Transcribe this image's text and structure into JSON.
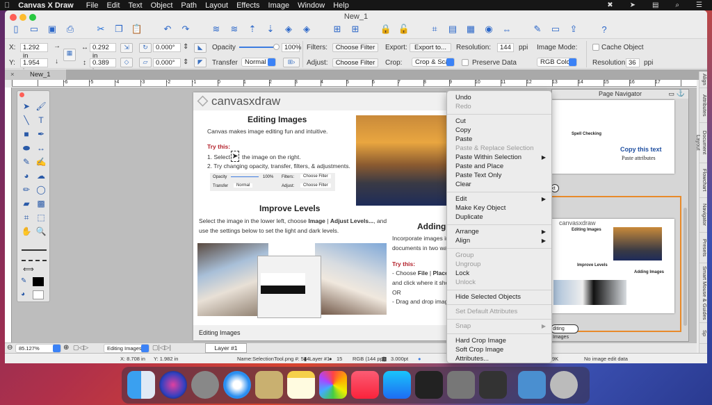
{
  "menubar": {
    "apple": "",
    "app": "Canvas X Draw",
    "items": [
      "File",
      "Edit",
      "Text",
      "Object",
      "Path",
      "Layout",
      "Effects",
      "Image",
      "Window",
      "Help"
    ],
    "status_icons": [
      "toolbox-icon",
      "cursor-icon",
      "flag-us-icon",
      "search-icon",
      "list-icon"
    ]
  },
  "window": {
    "title": "New_1",
    "tab": "New_1"
  },
  "toolbar": {
    "icons": [
      "new-document-icon",
      "open-icon",
      "save-icon",
      "print-icon",
      "cut-icon",
      "copy-icon",
      "paste-icon",
      "undo-icon",
      "redo-icon",
      "layer-back-icon",
      "layer-forward-icon",
      "move-up-icon",
      "move-down-icon",
      "bring-front-icon",
      "send-back-icon",
      "grid-icon",
      "grid-alt-icon",
      "lock-icon",
      "unlock-icon",
      "crop-icon",
      "frame-icon",
      "image-icon",
      "record-icon",
      "flip-icon",
      "edit-icon",
      "present-icon",
      "export-icon",
      "help-icon"
    ]
  },
  "props": {
    "x_label": "X:",
    "x_value": "1.292 in",
    "y_label": "Y:",
    "y_value": "1.954 in",
    "width_value": "0.292 in",
    "height_value": "0.389 in",
    "rotation_value": "0.000°",
    "skew_value": "0.000°",
    "opacity_label": "Opacity",
    "opacity_value": "100%",
    "opacity_percent": 100,
    "transfer_label": "Transfer",
    "transfer_value": "Normal",
    "filters_label": "Filters:",
    "filters_value": "Choose Filter",
    "adjust_label": "Adjust:",
    "adjust_value": "Choose Filter",
    "export_label": "Export:",
    "export_value": "Export to...",
    "crop_label": "Crop:",
    "crop_value": "Crop & Scale",
    "resolution_label": "Resolution:",
    "resolution_value": "144",
    "ppi": "ppi",
    "preserve_label": "Preserve Data",
    "image_mode_label": "Image Mode:",
    "image_mode_value": "RGB Color",
    "cache_label": "Cache Object",
    "resolution2_label": "Resolution:",
    "resolution2_value": "36",
    "ppi2": "ppi"
  },
  "ruler": {
    "ticks": [
      "-6",
      "-5",
      "-4",
      "-3",
      "-2",
      "-1",
      "0",
      "1",
      "2",
      "3",
      "4",
      "5",
      "6",
      "7",
      "8",
      "9",
      "10",
      "11",
      "12",
      "13",
      "14",
      "15",
      "16",
      "17"
    ]
  },
  "side_tabs": [
    "Align",
    "Attributes",
    "Document Layout",
    "Flowchart",
    "Navigator",
    "Presets",
    "Smart Mouse & Guides",
    "Sp"
  ],
  "page": {
    "logo": "canvasxdraw",
    "title": "Editing Images",
    "intro": "Canvas makes image editing fun and intuitive.",
    "try_this": "Try this:",
    "step1a": "1. Select",
    "step1b": "the image on the right.",
    "step2": "2. Try changing opacity, transfer, filters, & adjustments.",
    "mini_opacity": "Opacity",
    "mini_opacity_val": "100%",
    "mini_filters": "Filters:",
    "mini_choose": "Choose Filter",
    "mini_transfer": "Transfer",
    "mini_normal": "Normal",
    "mini_adjust": "Adjust:",
    "levels_title": "Improve Levels",
    "levels_text1a": "Select the image in the lower left, choose ",
    "levels_text1b": "Image",
    "levels_text1c": " | ",
    "levels_text1d": "Adjust Levels...",
    "levels_text1e": ", and",
    "levels_text2": "use the settings below to set the light and dark levels.",
    "adding_title": "Adding",
    "adding_text1": "Incorporate images in",
    "adding_text2": "documents in two way",
    "try_this2": "Try this:",
    "add1a": "- Choose ",
    "add1b": "File",
    "add1c": " | ",
    "add1d": "Place.",
    "add2": "and click where it sho",
    "add3": "OR",
    "add4": "- Drag and drop imag",
    "footer": "Editing Images"
  },
  "context_menu": [
    {
      "label": "Undo"
    },
    {
      "label": "Redo",
      "disabled": true
    },
    {
      "sep": true
    },
    {
      "label": "Cut"
    },
    {
      "label": "Copy"
    },
    {
      "label": "Paste"
    },
    {
      "label": "Paste & Replace Selection",
      "disabled": true
    },
    {
      "label": "Paste Within Selection",
      "submenu": true
    },
    {
      "label": "Paste and Place"
    },
    {
      "label": "Paste Text Only"
    },
    {
      "label": "Clear"
    },
    {
      "sep": true
    },
    {
      "label": "Edit",
      "submenu": true
    },
    {
      "label": "Make Key Object"
    },
    {
      "label": "Duplicate"
    },
    {
      "sep": true
    },
    {
      "label": "Arrange",
      "submenu": true
    },
    {
      "label": "Align",
      "submenu": true
    },
    {
      "sep": true
    },
    {
      "label": "Group",
      "disabled": true
    },
    {
      "label": "Ungroup",
      "disabled": true
    },
    {
      "label": "Lock"
    },
    {
      "label": "Unlock",
      "disabled": true
    },
    {
      "sep": true
    },
    {
      "label": "Hide Selected Objects"
    },
    {
      "sep": true
    },
    {
      "label": "Set Default Attributes",
      "disabled": true
    },
    {
      "sep": true
    },
    {
      "label": "Snap",
      "disabled": true,
      "submenu": true
    },
    {
      "sep": true
    },
    {
      "label": "Hard Crop Image"
    },
    {
      "label": "Soft Crop Image"
    },
    {
      "label": "Attributes..."
    }
  ],
  "navigator": {
    "title": "Page Navigator",
    "copy_text": "Copy this text",
    "paste_attr": "Paste attributes",
    "page_label_1": "xt",
    "spell": "Spell Checking",
    "thumb_logo": "canvasxdraw",
    "thumb_title": "Editing Images",
    "thumb_levels": "Improve Levels",
    "thumb_adding": "Adding Images",
    "page_label_2": "diting Images"
  },
  "bottombar": {
    "zoom": "85.127%",
    "page_select": "Editing Images",
    "layer_tab": "Layer #1"
  },
  "statusbar": {
    "x": "X: 8.708 in",
    "y": "Y: 1.982 in",
    "name": "Name:SelectionTool.png  #: 544",
    "layer": "Layer #1",
    "count": "15",
    "color": "RGB (144 ppi)",
    "stroke": "3.000pt",
    "size": "9K",
    "edit": "No image edit data"
  },
  "dock": [
    "finder",
    "siri",
    "launchpad",
    "safari",
    "mail",
    "notes",
    "photos",
    "music",
    "app-store",
    "terminal",
    "system-preferences",
    "canvas-x-draw",
    "downloads",
    "trash"
  ],
  "colors": {
    "accent": "#2a66c8",
    "try_red": "#b3202a",
    "navigator_highlight": "#e88a2a"
  }
}
